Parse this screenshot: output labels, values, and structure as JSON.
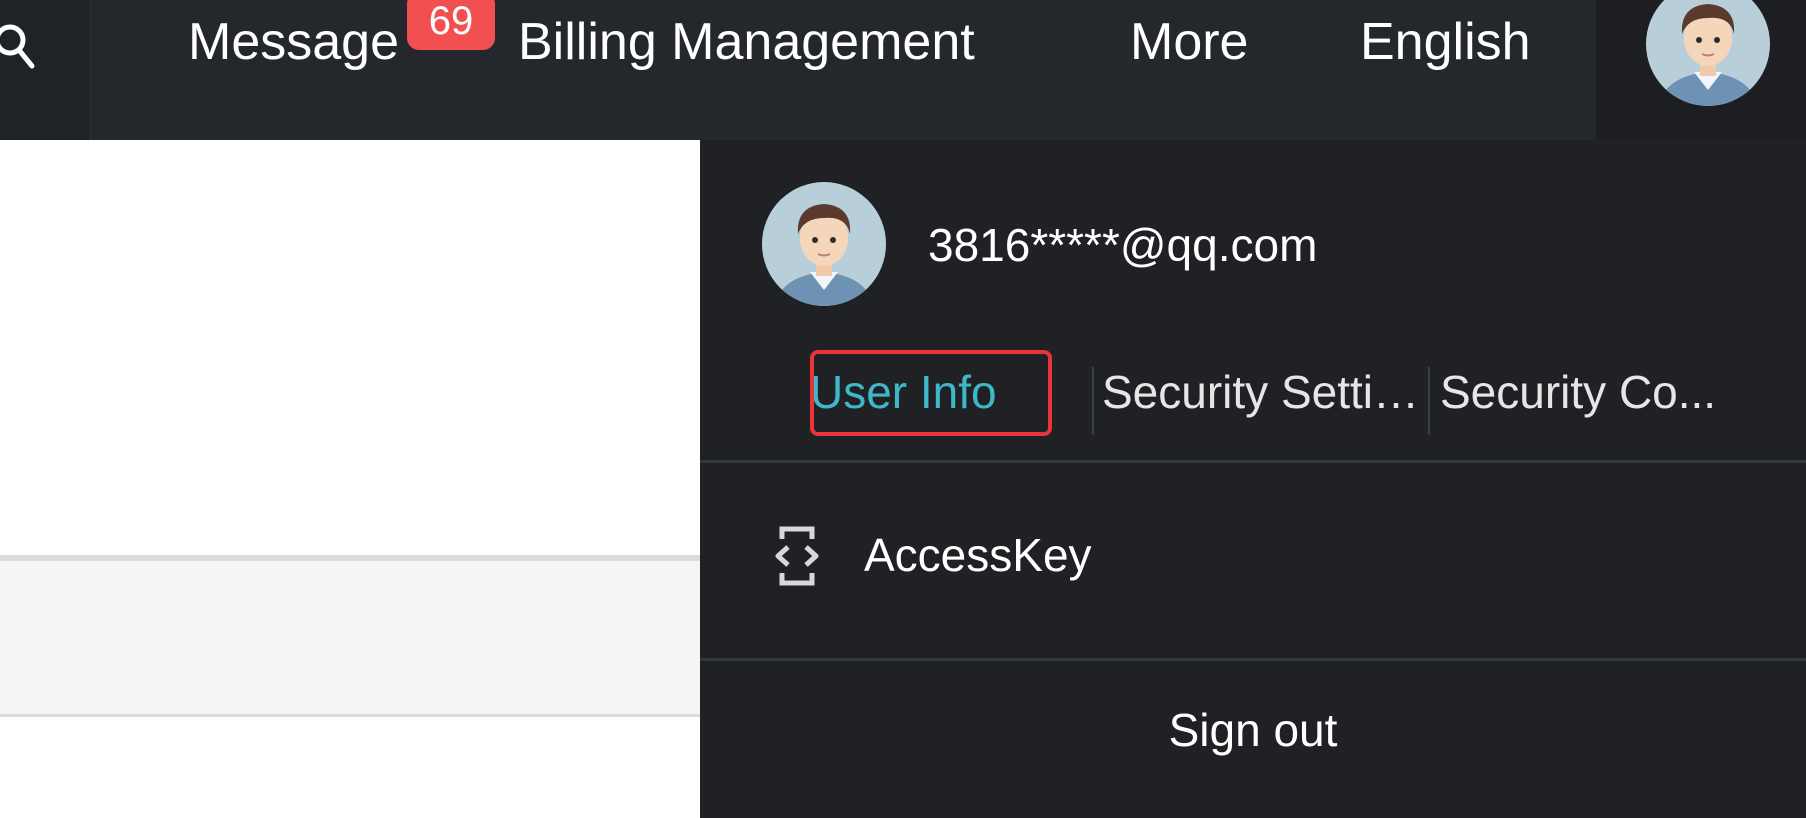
{
  "topbar": {
    "search_icon": "search-icon",
    "nav": {
      "message_label": "Message",
      "message_badge": "69",
      "billing_label": "Billing Management",
      "more_label": "More",
      "language_label": "English"
    },
    "avatar_icon": "user-avatar-icon"
  },
  "dropdown": {
    "avatar_icon": "user-avatar-icon",
    "email": "3816*****@qq.com",
    "tabs": [
      {
        "label": "User Info",
        "active": true
      },
      {
        "label": "Security Settings"
      },
      {
        "label": "Security Co..."
      }
    ],
    "accesskey": {
      "icon": "braces-icon",
      "label": "AccessKey"
    },
    "signout_label": "Sign out"
  },
  "colors": {
    "topbar_bg": "#24272c",
    "panel_bg": "#1f2125",
    "accent": "#3fb7c9",
    "badge": "#f25050",
    "highlight_border": "#e8353a"
  }
}
